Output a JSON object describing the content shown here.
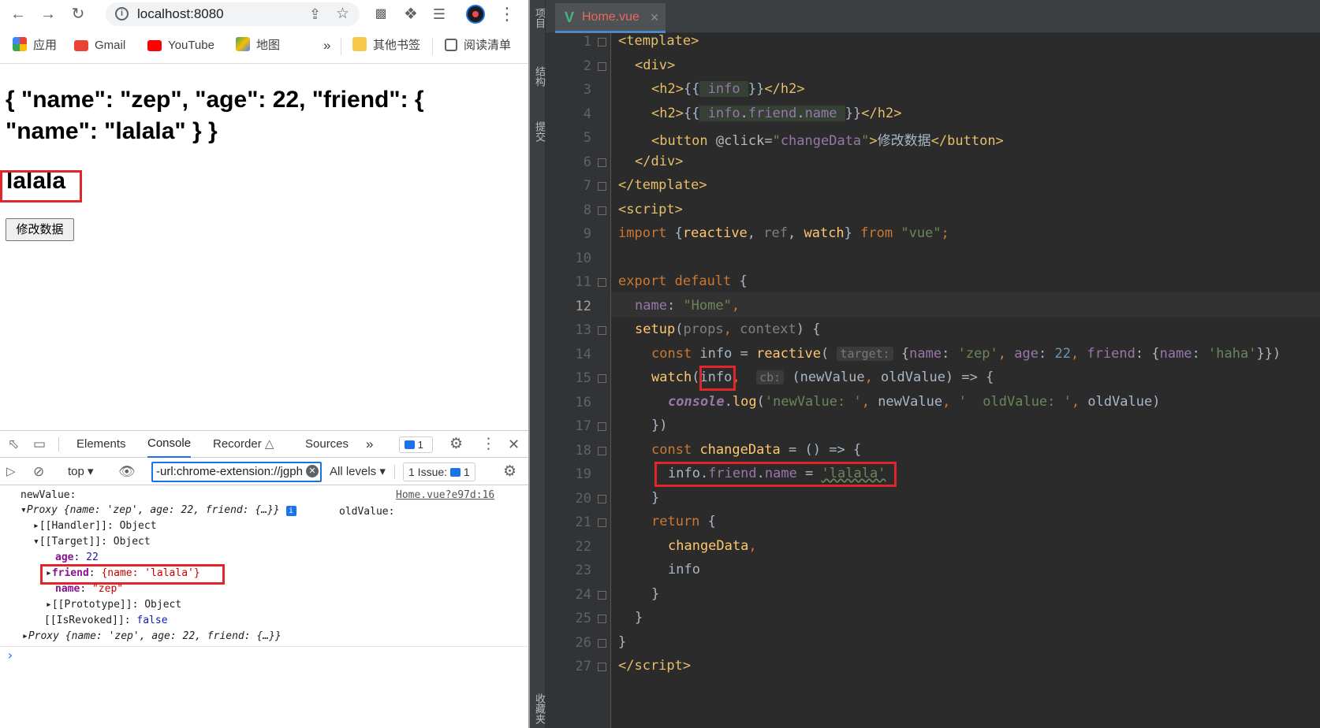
{
  "browser": {
    "url": "localhost:8080",
    "bookmarks": [
      "应用",
      "Gmail",
      "YouTube",
      "地图",
      "其他书签",
      "阅读清单"
    ],
    "more": "»"
  },
  "page": {
    "h2_info": "{ \"name\": \"zep\", \"age\": 22, \"friend\": { \"name\": \"lalala\" } }",
    "h2_name": "lalala",
    "button": "修改数据"
  },
  "devtools": {
    "tabs": [
      "Elements",
      "Console",
      "Recorder",
      "Sources",
      "»"
    ],
    "issues_badge": "1",
    "context": "top",
    "filter": "-url:chrome-extension://jgph",
    "levels": "All levels",
    "issues": "1 Issue:",
    "issues_count": "1"
  },
  "console": {
    "new_value": "newValue:",
    "source": "Home.vue?e97d:16",
    "proxy1": "Proxy {name: 'zep', age: 22, friend: {…}}",
    "old_value": "oldValue:",
    "handler": "[[Handler]]: Object",
    "target": "[[Target]]: Object",
    "age_key": "age",
    "age_val": "22",
    "friend_key": "friend",
    "friend_val": "{name: 'lalala'}",
    "name_key": "name",
    "name_val": "\"zep\"",
    "prototype": "[[Prototype]]: Object",
    "revoked_key": "[[IsRevoked]]:",
    "revoked_val": "false",
    "proxy2": "Proxy {name: 'zep', age: 22, friend: {…}}",
    "prompt": "›"
  },
  "ide": {
    "file_tab": "Home.vue",
    "side_labels": [
      "项目",
      "结构",
      "提交",
      "收藏夹"
    ],
    "current_line": 12,
    "lines": [
      "1",
      "2",
      "3",
      "4",
      "5",
      "6",
      "7",
      "8",
      "9",
      "10",
      "11",
      "12",
      "13",
      "14",
      "15",
      "16",
      "17",
      "18",
      "19",
      "20",
      "21",
      "22",
      "23",
      "24",
      "25",
      "26",
      "27"
    ]
  }
}
